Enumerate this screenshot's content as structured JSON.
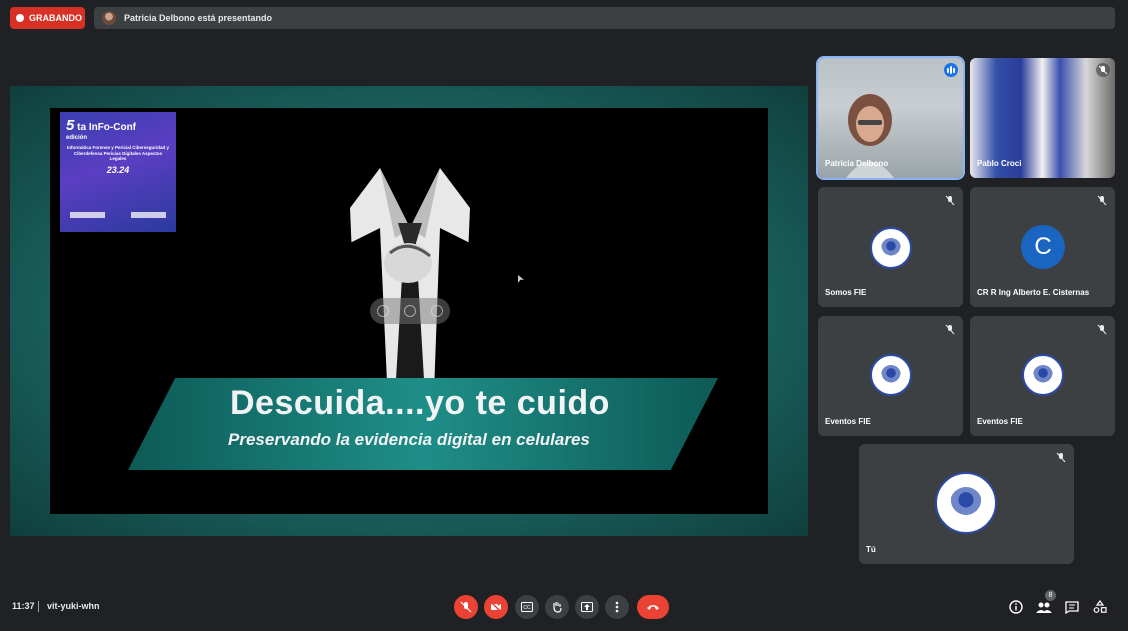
{
  "recording": {
    "label": "GRABANDO"
  },
  "presenting": {
    "text": "Patricia Delbono está presentando"
  },
  "slide": {
    "title": "Descuida....yo te cuido",
    "subtitle": "Preservando la evidencia digital en celulares",
    "poster": {
      "edition_number": "5",
      "edition_suffix": "ta",
      "brand": "InFo-Conf",
      "edition_word": "edición",
      "topics": "Informática Forense y Pericial Ciberseguridad y Ciberdefensa Pericias Digitales Aspectos Legales",
      "dates": "23.24"
    }
  },
  "participants": [
    {
      "name": "Patricia Delbono",
      "speaking": true
    },
    {
      "name": "Pablo Croci",
      "muted": true
    },
    {
      "name": "Somos FIE",
      "muted": true
    },
    {
      "name": "CR R Ing Alberto E. Cisternas",
      "initial": "C",
      "muted": true
    },
    {
      "name": "Eventos FIE",
      "muted": true
    },
    {
      "name": "Eventos FIE",
      "muted": true
    },
    {
      "name": "Tú",
      "muted": true
    }
  ],
  "bottom_bar": {
    "time": "11:37",
    "meeting_code": "vit-yuki-whn",
    "people_count": "8"
  },
  "icons": {
    "mic": "mic-off-icon",
    "camera": "camera-off-icon",
    "captions": "captions-icon",
    "hand": "raise-hand-icon",
    "present": "present-icon",
    "more": "more-options-icon",
    "leave": "leave-call-icon",
    "info": "info-icon",
    "people": "people-icon",
    "chat": "chat-icon",
    "activities": "activities-icon"
  },
  "colors": {
    "recording": "#d93025",
    "leave": "#ea4335",
    "active_border": "#8ab4f8",
    "avatar": "#1a65c1"
  }
}
